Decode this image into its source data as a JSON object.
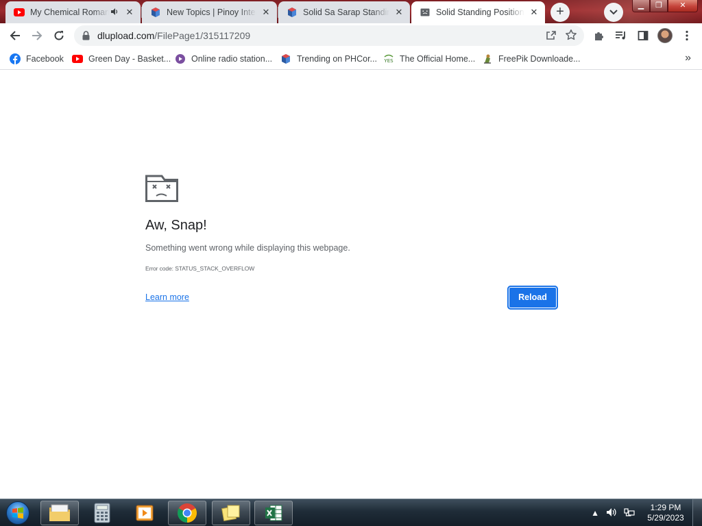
{
  "browser": {
    "tabs": [
      {
        "title": "My Chemical Romance",
        "favicon": "youtube-icon",
        "audio": true,
        "active": false
      },
      {
        "title": "New Topics | Pinoy Internet",
        "favicon": "pinoy-internet-icon",
        "audio": false,
        "active": false
      },
      {
        "title": "Solid Sa Sarap Standing Position",
        "favicon": "pinoy-internet-icon",
        "audio": false,
        "active": false
      },
      {
        "title": "Solid Standing Position - dlupload",
        "favicon": "sad-page-icon",
        "audio": false,
        "active": true
      }
    ],
    "url": {
      "domain": "dlupload.com",
      "path": "/FilePage1/315117209"
    },
    "bookmarks": [
      {
        "label": "Facebook",
        "icon": "facebook-icon"
      },
      {
        "label": "Green Day - Basket...",
        "icon": "youtube-icon"
      },
      {
        "label": "Online radio station...",
        "icon": "radio-icon"
      },
      {
        "label": "Trending on PHCor...",
        "icon": "phcorner-icon"
      },
      {
        "label": "The Official Home...",
        "icon": "official-home-icon"
      },
      {
        "label": "FreePik Downloade...",
        "icon": "freepik-icon"
      }
    ]
  },
  "error_page": {
    "title": "Aw, Snap!",
    "message": "Something went wrong while displaying this webpage.",
    "error_code": "Error code: STATUS_STACK_OVERFLOW",
    "learn_more": "Learn more",
    "reload": "Reload"
  },
  "taskbar": {
    "apps": [
      "file-explorer-icon",
      "calculator-icon",
      "media-player-icon",
      "chrome-icon",
      "sticky-notes-icon",
      "excel-icon"
    ],
    "active_app": "chrome-icon",
    "time": "1:29 PM",
    "date": "5/29/2023"
  },
  "colors": {
    "accent": "#1a73e8",
    "titlebar": "#8a2328",
    "taskbar": "#1f2c38"
  }
}
